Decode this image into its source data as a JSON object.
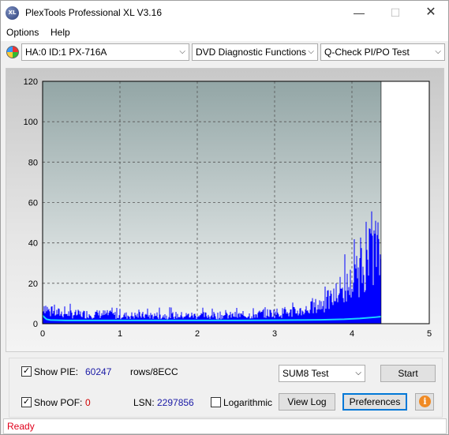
{
  "window": {
    "title": "PlexTools Professional XL V3.16",
    "app_icon_text": "XL",
    "minimize_glyph": "—",
    "maximize_glyph": "☐",
    "close_glyph": "✕"
  },
  "menu": {
    "items": [
      {
        "label": "Options"
      },
      {
        "label": "Help"
      }
    ]
  },
  "toolbar": {
    "drive": "HA:0 ID:1  PX-716A",
    "function": "DVD Diagnostic Functions",
    "test": "Q-Check PI/PO Test",
    "chevron": "⌵"
  },
  "chart_data": {
    "type": "area",
    "x_ticks": [
      "0",
      "1",
      "2",
      "3",
      "4",
      "5"
    ],
    "y_ticks": [
      "0",
      "20",
      "40",
      "60",
      "80",
      "100",
      "120"
    ],
    "xlim": [
      0,
      5
    ],
    "ylim": [
      0,
      120
    ],
    "grid": true,
    "end_marker_x": 4.38,
    "series": [
      {
        "kind": "pie-bars",
        "color": "#0000ff",
        "x": [
          0.0,
          0.1,
          0.2,
          0.4,
          0.6,
          0.8,
          1.0,
          1.2,
          1.4,
          1.6,
          1.8,
          2.0,
          2.2,
          2.4,
          2.6,
          2.8,
          3.0,
          3.2,
          3.4,
          3.5,
          3.6,
          3.7,
          3.8,
          3.9,
          4.0,
          4.05,
          4.1,
          4.15,
          4.2,
          4.25,
          4.3,
          4.35,
          4.38
        ],
        "y": [
          15,
          8,
          8,
          7,
          7,
          7,
          6,
          6,
          6,
          6,
          6,
          6,
          6,
          6,
          6,
          7,
          8,
          8,
          10,
          12,
          14,
          17,
          20,
          25,
          30,
          32,
          38,
          42,
          45,
          50,
          56,
          50,
          45
        ]
      },
      {
        "kind": "sum-line",
        "color": "#19d5ff",
        "x": [
          0.0,
          0.05,
          0.1,
          0.3,
          0.6,
          1.0,
          1.5,
          2.0,
          2.5,
          3.0,
          3.3,
          3.6,
          3.9,
          4.1,
          4.3,
          4.38
        ],
        "y": [
          4,
          2.2,
          1.8,
          1.6,
          1.6,
          1.6,
          1.6,
          1.6,
          1.6,
          1.7,
          1.8,
          1.9,
          2.2,
          2.6,
          3.2,
          3.5
        ]
      }
    ],
    "colors": {
      "plot_bg_top": "#93a6a6",
      "plot_bg_bottom": "#f4f6f6",
      "grid": "#555555"
    }
  },
  "controls": {
    "show_pie_label": "Show PIE:",
    "show_pie_checked": "✓",
    "pie_value": "60247",
    "rows_unit": "rows/8ECC",
    "show_pof_label": "Show POF:",
    "show_pof_checked": "✓",
    "pof_value": "0",
    "lsn_label": "LSN:",
    "lsn_value": "2297856",
    "logarithmic_label": "Logarithmic",
    "sum_select": "SUM8 Test",
    "start_label": "Start",
    "view_log_label": "View Log",
    "preferences_label": "Preferences",
    "info_glyph": "i"
  },
  "status": {
    "text": "Ready"
  }
}
